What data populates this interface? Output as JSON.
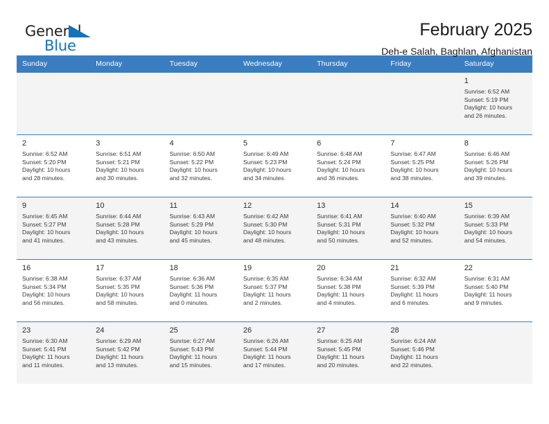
{
  "brand": {
    "name_part1": "General",
    "name_part2": "Blue",
    "accent_color": "#1273bd"
  },
  "header": {
    "month_title": "February 2025",
    "location": "Deh-e Salah, Baghlan, Afghanistan"
  },
  "calendar": {
    "header_color": "#3a7dc0",
    "weekdays": [
      "Sunday",
      "Monday",
      "Tuesday",
      "Wednesday",
      "Thursday",
      "Friday",
      "Saturday"
    ],
    "weeks": [
      [
        {
          "day": "",
          "sunrise": "",
          "sunset": "",
          "daylight_line1": "",
          "daylight_line2": ""
        },
        {
          "day": "",
          "sunrise": "",
          "sunset": "",
          "daylight_line1": "",
          "daylight_line2": ""
        },
        {
          "day": "",
          "sunrise": "",
          "sunset": "",
          "daylight_line1": "",
          "daylight_line2": ""
        },
        {
          "day": "",
          "sunrise": "",
          "sunset": "",
          "daylight_line1": "",
          "daylight_line2": ""
        },
        {
          "day": "",
          "sunrise": "",
          "sunset": "",
          "daylight_line1": "",
          "daylight_line2": ""
        },
        {
          "day": "",
          "sunrise": "",
          "sunset": "",
          "daylight_line1": "",
          "daylight_line2": ""
        },
        {
          "day": "1",
          "sunrise": "Sunrise: 6:52 AM",
          "sunset": "Sunset: 5:19 PM",
          "daylight_line1": "Daylight: 10 hours",
          "daylight_line2": "and 26 minutes."
        }
      ],
      [
        {
          "day": "2",
          "sunrise": "Sunrise: 6:52 AM",
          "sunset": "Sunset: 5:20 PM",
          "daylight_line1": "Daylight: 10 hours",
          "daylight_line2": "and 28 minutes."
        },
        {
          "day": "3",
          "sunrise": "Sunrise: 6:51 AM",
          "sunset": "Sunset: 5:21 PM",
          "daylight_line1": "Daylight: 10 hours",
          "daylight_line2": "and 30 minutes."
        },
        {
          "day": "4",
          "sunrise": "Sunrise: 6:50 AM",
          "sunset": "Sunset: 5:22 PM",
          "daylight_line1": "Daylight: 10 hours",
          "daylight_line2": "and 32 minutes."
        },
        {
          "day": "5",
          "sunrise": "Sunrise: 6:49 AM",
          "sunset": "Sunset: 5:23 PM",
          "daylight_line1": "Daylight: 10 hours",
          "daylight_line2": "and 34 minutes."
        },
        {
          "day": "6",
          "sunrise": "Sunrise: 6:48 AM",
          "sunset": "Sunset: 5:24 PM",
          "daylight_line1": "Daylight: 10 hours",
          "daylight_line2": "and 36 minutes."
        },
        {
          "day": "7",
          "sunrise": "Sunrise: 6:47 AM",
          "sunset": "Sunset: 5:25 PM",
          "daylight_line1": "Daylight: 10 hours",
          "daylight_line2": "and 38 minutes."
        },
        {
          "day": "8",
          "sunrise": "Sunrise: 6:46 AM",
          "sunset": "Sunset: 5:26 PM",
          "daylight_line1": "Daylight: 10 hours",
          "daylight_line2": "and 39 minutes."
        }
      ],
      [
        {
          "day": "9",
          "sunrise": "Sunrise: 6:45 AM",
          "sunset": "Sunset: 5:27 PM",
          "daylight_line1": "Daylight: 10 hours",
          "daylight_line2": "and 41 minutes."
        },
        {
          "day": "10",
          "sunrise": "Sunrise: 6:44 AM",
          "sunset": "Sunset: 5:28 PM",
          "daylight_line1": "Daylight: 10 hours",
          "daylight_line2": "and 43 minutes."
        },
        {
          "day": "11",
          "sunrise": "Sunrise: 6:43 AM",
          "sunset": "Sunset: 5:29 PM",
          "daylight_line1": "Daylight: 10 hours",
          "daylight_line2": "and 45 minutes."
        },
        {
          "day": "12",
          "sunrise": "Sunrise: 6:42 AM",
          "sunset": "Sunset: 5:30 PM",
          "daylight_line1": "Daylight: 10 hours",
          "daylight_line2": "and 48 minutes."
        },
        {
          "day": "13",
          "sunrise": "Sunrise: 6:41 AM",
          "sunset": "Sunset: 5:31 PM",
          "daylight_line1": "Daylight: 10 hours",
          "daylight_line2": "and 50 minutes."
        },
        {
          "day": "14",
          "sunrise": "Sunrise: 6:40 AM",
          "sunset": "Sunset: 5:32 PM",
          "daylight_line1": "Daylight: 10 hours",
          "daylight_line2": "and 52 minutes."
        },
        {
          "day": "15",
          "sunrise": "Sunrise: 6:39 AM",
          "sunset": "Sunset: 5:33 PM",
          "daylight_line1": "Daylight: 10 hours",
          "daylight_line2": "and 54 minutes."
        }
      ],
      [
        {
          "day": "16",
          "sunrise": "Sunrise: 6:38 AM",
          "sunset": "Sunset: 5:34 PM",
          "daylight_line1": "Daylight: 10 hours",
          "daylight_line2": "and 56 minutes."
        },
        {
          "day": "17",
          "sunrise": "Sunrise: 6:37 AM",
          "sunset": "Sunset: 5:35 PM",
          "daylight_line1": "Daylight: 10 hours",
          "daylight_line2": "and 58 minutes."
        },
        {
          "day": "18",
          "sunrise": "Sunrise: 6:36 AM",
          "sunset": "Sunset: 5:36 PM",
          "daylight_line1": "Daylight: 11 hours",
          "daylight_line2": "and 0 minutes."
        },
        {
          "day": "19",
          "sunrise": "Sunrise: 6:35 AM",
          "sunset": "Sunset: 5:37 PM",
          "daylight_line1": "Daylight: 11 hours",
          "daylight_line2": "and 2 minutes."
        },
        {
          "day": "20",
          "sunrise": "Sunrise: 6:34 AM",
          "sunset": "Sunset: 5:38 PM",
          "daylight_line1": "Daylight: 11 hours",
          "daylight_line2": "and 4 minutes."
        },
        {
          "day": "21",
          "sunrise": "Sunrise: 6:32 AM",
          "sunset": "Sunset: 5:39 PM",
          "daylight_line1": "Daylight: 11 hours",
          "daylight_line2": "and 6 minutes."
        },
        {
          "day": "22",
          "sunrise": "Sunrise: 6:31 AM",
          "sunset": "Sunset: 5:40 PM",
          "daylight_line1": "Daylight: 11 hours",
          "daylight_line2": "and 9 minutes."
        }
      ],
      [
        {
          "day": "23",
          "sunrise": "Sunrise: 6:30 AM",
          "sunset": "Sunset: 5:41 PM",
          "daylight_line1": "Daylight: 11 hours",
          "daylight_line2": "and 11 minutes."
        },
        {
          "day": "24",
          "sunrise": "Sunrise: 6:29 AM",
          "sunset": "Sunset: 5:42 PM",
          "daylight_line1": "Daylight: 11 hours",
          "daylight_line2": "and 13 minutes."
        },
        {
          "day": "25",
          "sunrise": "Sunrise: 6:27 AM",
          "sunset": "Sunset: 5:43 PM",
          "daylight_line1": "Daylight: 11 hours",
          "daylight_line2": "and 15 minutes."
        },
        {
          "day": "26",
          "sunrise": "Sunrise: 6:26 AM",
          "sunset": "Sunset: 5:44 PM",
          "daylight_line1": "Daylight: 11 hours",
          "daylight_line2": "and 17 minutes."
        },
        {
          "day": "27",
          "sunrise": "Sunrise: 6:25 AM",
          "sunset": "Sunset: 5:45 PM",
          "daylight_line1": "Daylight: 11 hours",
          "daylight_line2": "and 20 minutes."
        },
        {
          "day": "28",
          "sunrise": "Sunrise: 6:24 AM",
          "sunset": "Sunset: 5:46 PM",
          "daylight_line1": "Daylight: 11 hours",
          "daylight_line2": "and 22 minutes."
        },
        {
          "day": "",
          "sunrise": "",
          "sunset": "",
          "daylight_line1": "",
          "daylight_line2": ""
        }
      ]
    ]
  }
}
